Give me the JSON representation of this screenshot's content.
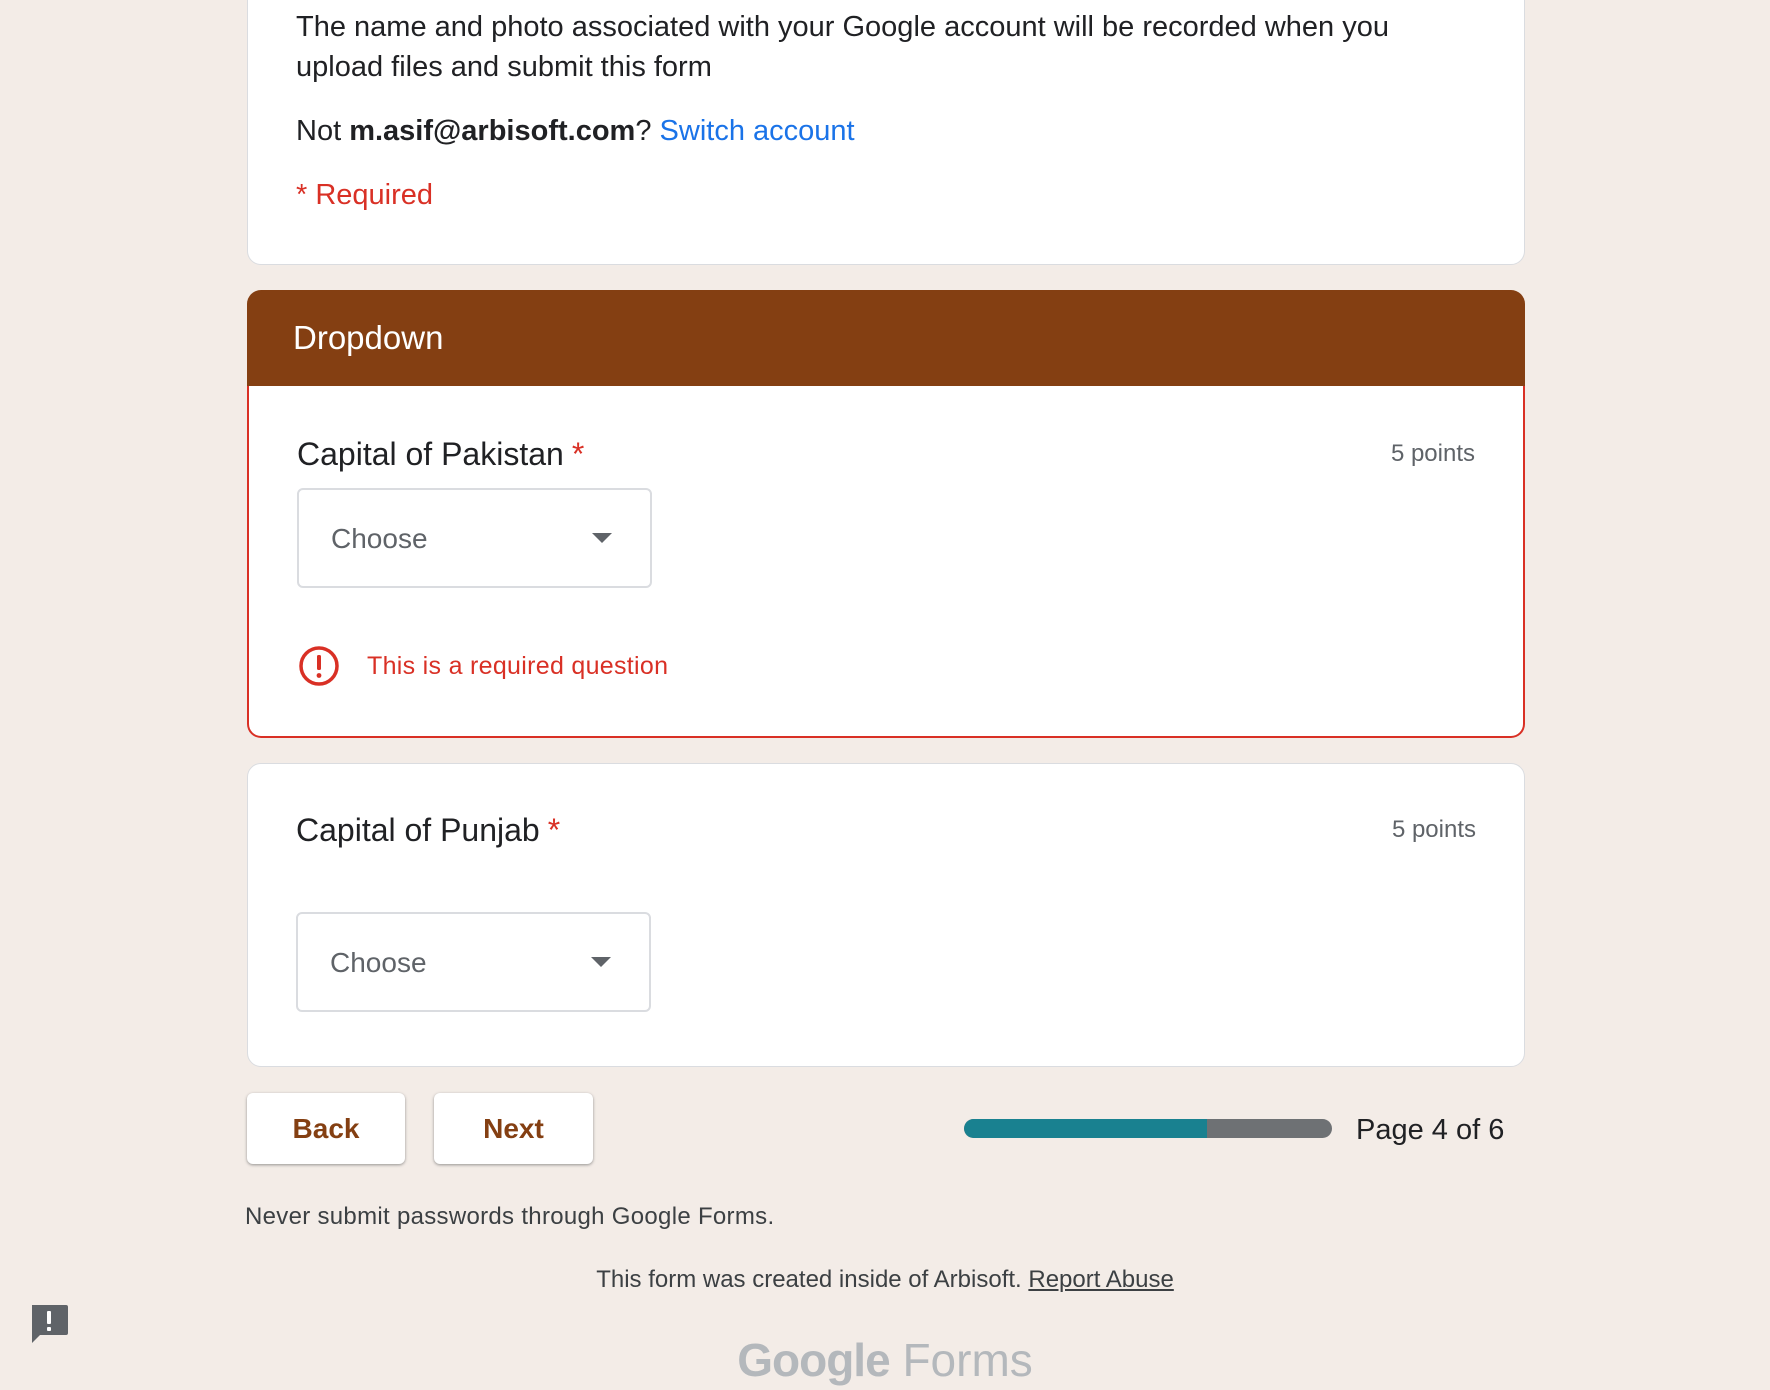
{
  "header": {
    "notice": "The name and photo associated with your Google account will be recorded when you upload files and submit this form",
    "account_prefix": "Not",
    "account_email": "m.asif@arbisoft.com",
    "account_suffix": "?",
    "switch_account": "Switch account",
    "required_note": "* Required"
  },
  "section": {
    "title": "Dropdown",
    "color": "#843f12"
  },
  "questions": [
    {
      "title": "Capital of Pakistan",
      "required_mark": "*",
      "points": "5 points",
      "placeholder": "Choose",
      "error": "This is a required question"
    },
    {
      "title": "Capital of Punjab",
      "required_mark": "*",
      "points": "5 points",
      "placeholder": "Choose"
    }
  ],
  "nav": {
    "back_label": "Back",
    "next_label": "Next",
    "page_indicator": "Page 4 of 6",
    "progress": 0.66
  },
  "footer": {
    "warning": "Never submit passwords through Google Forms.",
    "created_text": "This form was created inside of Arbisoft.",
    "report_abuse": "Report Abuse",
    "logo_google": "Google",
    "logo_forms": "Forms"
  },
  "icons": {
    "error": "error-circle-icon",
    "dropdown": "caret-down-icon",
    "feedback": "feedback-icon"
  },
  "colors": {
    "accent": "#843f12",
    "error": "#d93025",
    "link": "#1a73e8",
    "progress": "#198190",
    "background": "#f3ece7"
  }
}
